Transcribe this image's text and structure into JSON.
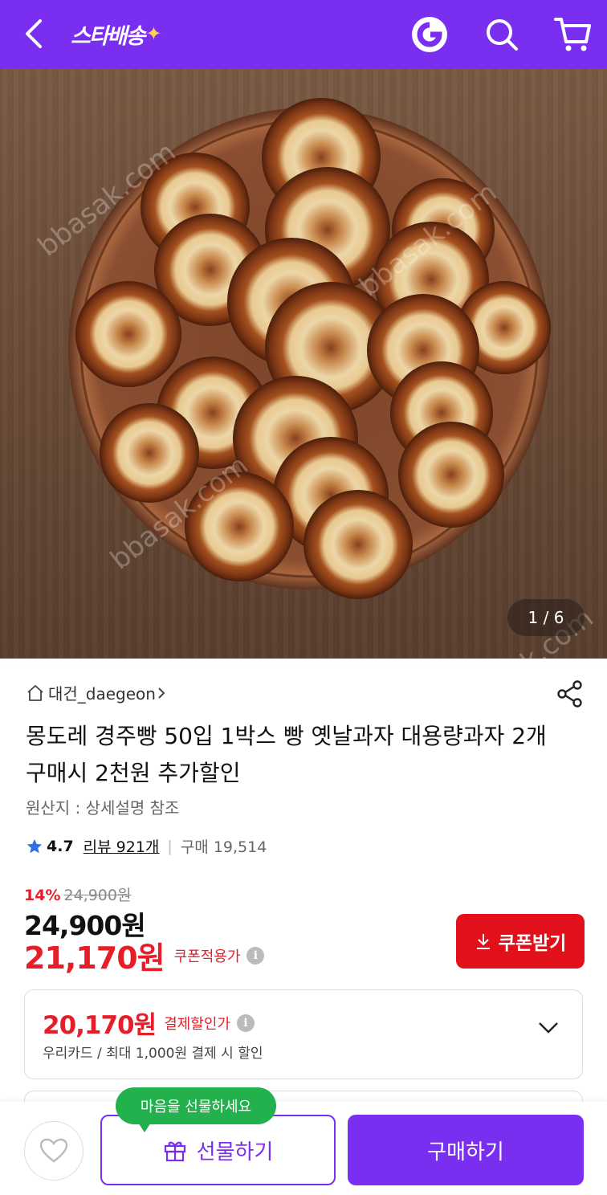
{
  "header": {
    "logo_text": "스타배송",
    "logo_spark": "✦",
    "icons": [
      "back-icon",
      "g-logo-icon",
      "search-icon",
      "cart-icon"
    ]
  },
  "hero": {
    "counter": "1 / 6",
    "watermark": "bbasak.com"
  },
  "product": {
    "seller": "대건_daegeon",
    "title": "몽도레 경주빵 50입 1박스 빵 옛날과자 대용량과자 2개 구매시 2천원 추가할인",
    "origin": "원산지 : 상세설명 참조",
    "rating": "4.7",
    "reviews": "리뷰 921개",
    "sold": "구매 19,514"
  },
  "price": {
    "discount": "14%",
    "original": "24,900원",
    "sale": "24,900원",
    "coupon_price": "21,170원",
    "coupon_label": "쿠폰적용가",
    "coupon_button": "쿠폰받기",
    "pay_price": "20,170원",
    "pay_label": "결제할인가",
    "pay_sub": "우리카드 / 최대 1,000원 결제 시 할인"
  },
  "bottom": {
    "tooltip": "마음을 선물하세요",
    "gift_button": "선물하기",
    "buy_button": "구매하기"
  },
  "colors": {
    "brand": "#7a2ff0",
    "red": "#e61e2a",
    "coupon_button": "#e1101b",
    "tooltip": "#22b14c",
    "star": "#2f6fe4"
  }
}
